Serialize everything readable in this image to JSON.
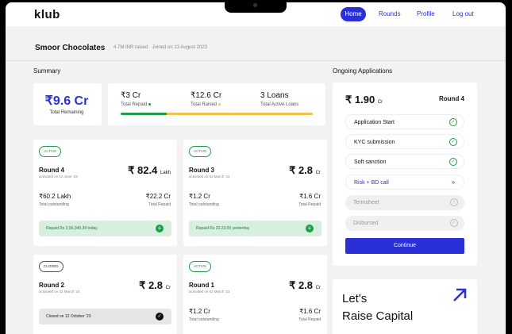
{
  "app": {
    "logo": "klub"
  },
  "nav": {
    "home": "Home",
    "rounds": "Rounds",
    "profile": "Profile",
    "logout": "Log out"
  },
  "company": {
    "name": "Smoor Chocolates",
    "meta": "4.7M INR raised · Joined on 13 August 2023"
  },
  "summary": {
    "title": "Summary",
    "remaining_amount": "₹9.6 Cr",
    "remaining_label": "Total Remaining",
    "repaid_value": "₹3 Cr",
    "repaid_label": "Total Repaid",
    "raised_value": "₹12.6 Cr",
    "raised_label": "Total Raised",
    "loans_value": "3 Loans",
    "loans_label": "Total Active Loans",
    "repaid_fraction": 0.24,
    "colors": {
      "repaid": "#1e9e4a",
      "raised": "#f3c24a"
    }
  },
  "rounds": [
    {
      "status": "ACTIVE",
      "name": "Round 4",
      "activated": "activated on 12 June '23",
      "amount": "₹ 82.4",
      "unit": "Lakh",
      "outstanding": "₹60.2 Lakh",
      "outstanding_label": "Total outstanding",
      "repaid": "₹22.2 Cr",
      "repaid_label": "Total Repaid",
      "footer": "Repaid Rs 2,56,345.39 today",
      "footer_icon": "plus-icon"
    },
    {
      "status": "ACTIVE",
      "name": "Round 3",
      "activated": "activated on 02 March '23",
      "amount": "₹ 2.8",
      "unit": "Cr",
      "outstanding": "₹1.2 Cr",
      "outstanding_label": "Total outstanding",
      "repaid": "₹1.6 Cr",
      "repaid_label": "Total Repaid",
      "footer": "Repaid Rs 32,23,00 yesterday",
      "footer_icon": "plus-icon"
    },
    {
      "status": "CLOSED",
      "name": "Round 2",
      "activated": "activated on 02 March '23",
      "amount": "₹ 2.8",
      "unit": "Cr",
      "footer": "Closed on 12 October '23",
      "footer_icon": "check-icon"
    },
    {
      "status": "ACTIVE",
      "name": "Round 1",
      "activated": "activated on 02 March '23",
      "amount": "₹ 2.8",
      "unit": "Cr",
      "outstanding": "₹1.2 Cr",
      "outstanding_label": "Total outstanding",
      "repaid": "₹1.6 Cr",
      "repaid_label": "Total Repaid"
    }
  ],
  "ongoing": {
    "title": "Ongoing Applications",
    "amount": "₹ 1.90",
    "unit": "Cr",
    "round": "Round 4",
    "steps": [
      {
        "label": "Application Start",
        "state": "done"
      },
      {
        "label": "KYC submission",
        "state": "done"
      },
      {
        "label": "Soft sanction",
        "state": "done"
      },
      {
        "label": "Risk + BD call",
        "state": "current"
      },
      {
        "label": "Termsheet",
        "state": "pending"
      },
      {
        "label": "Disbursed",
        "state": "pending"
      }
    ],
    "continue_label": "Continue"
  },
  "raise": {
    "line1": "Let's",
    "line2": "Raise Capital"
  },
  "accent": "#2a2fd6"
}
